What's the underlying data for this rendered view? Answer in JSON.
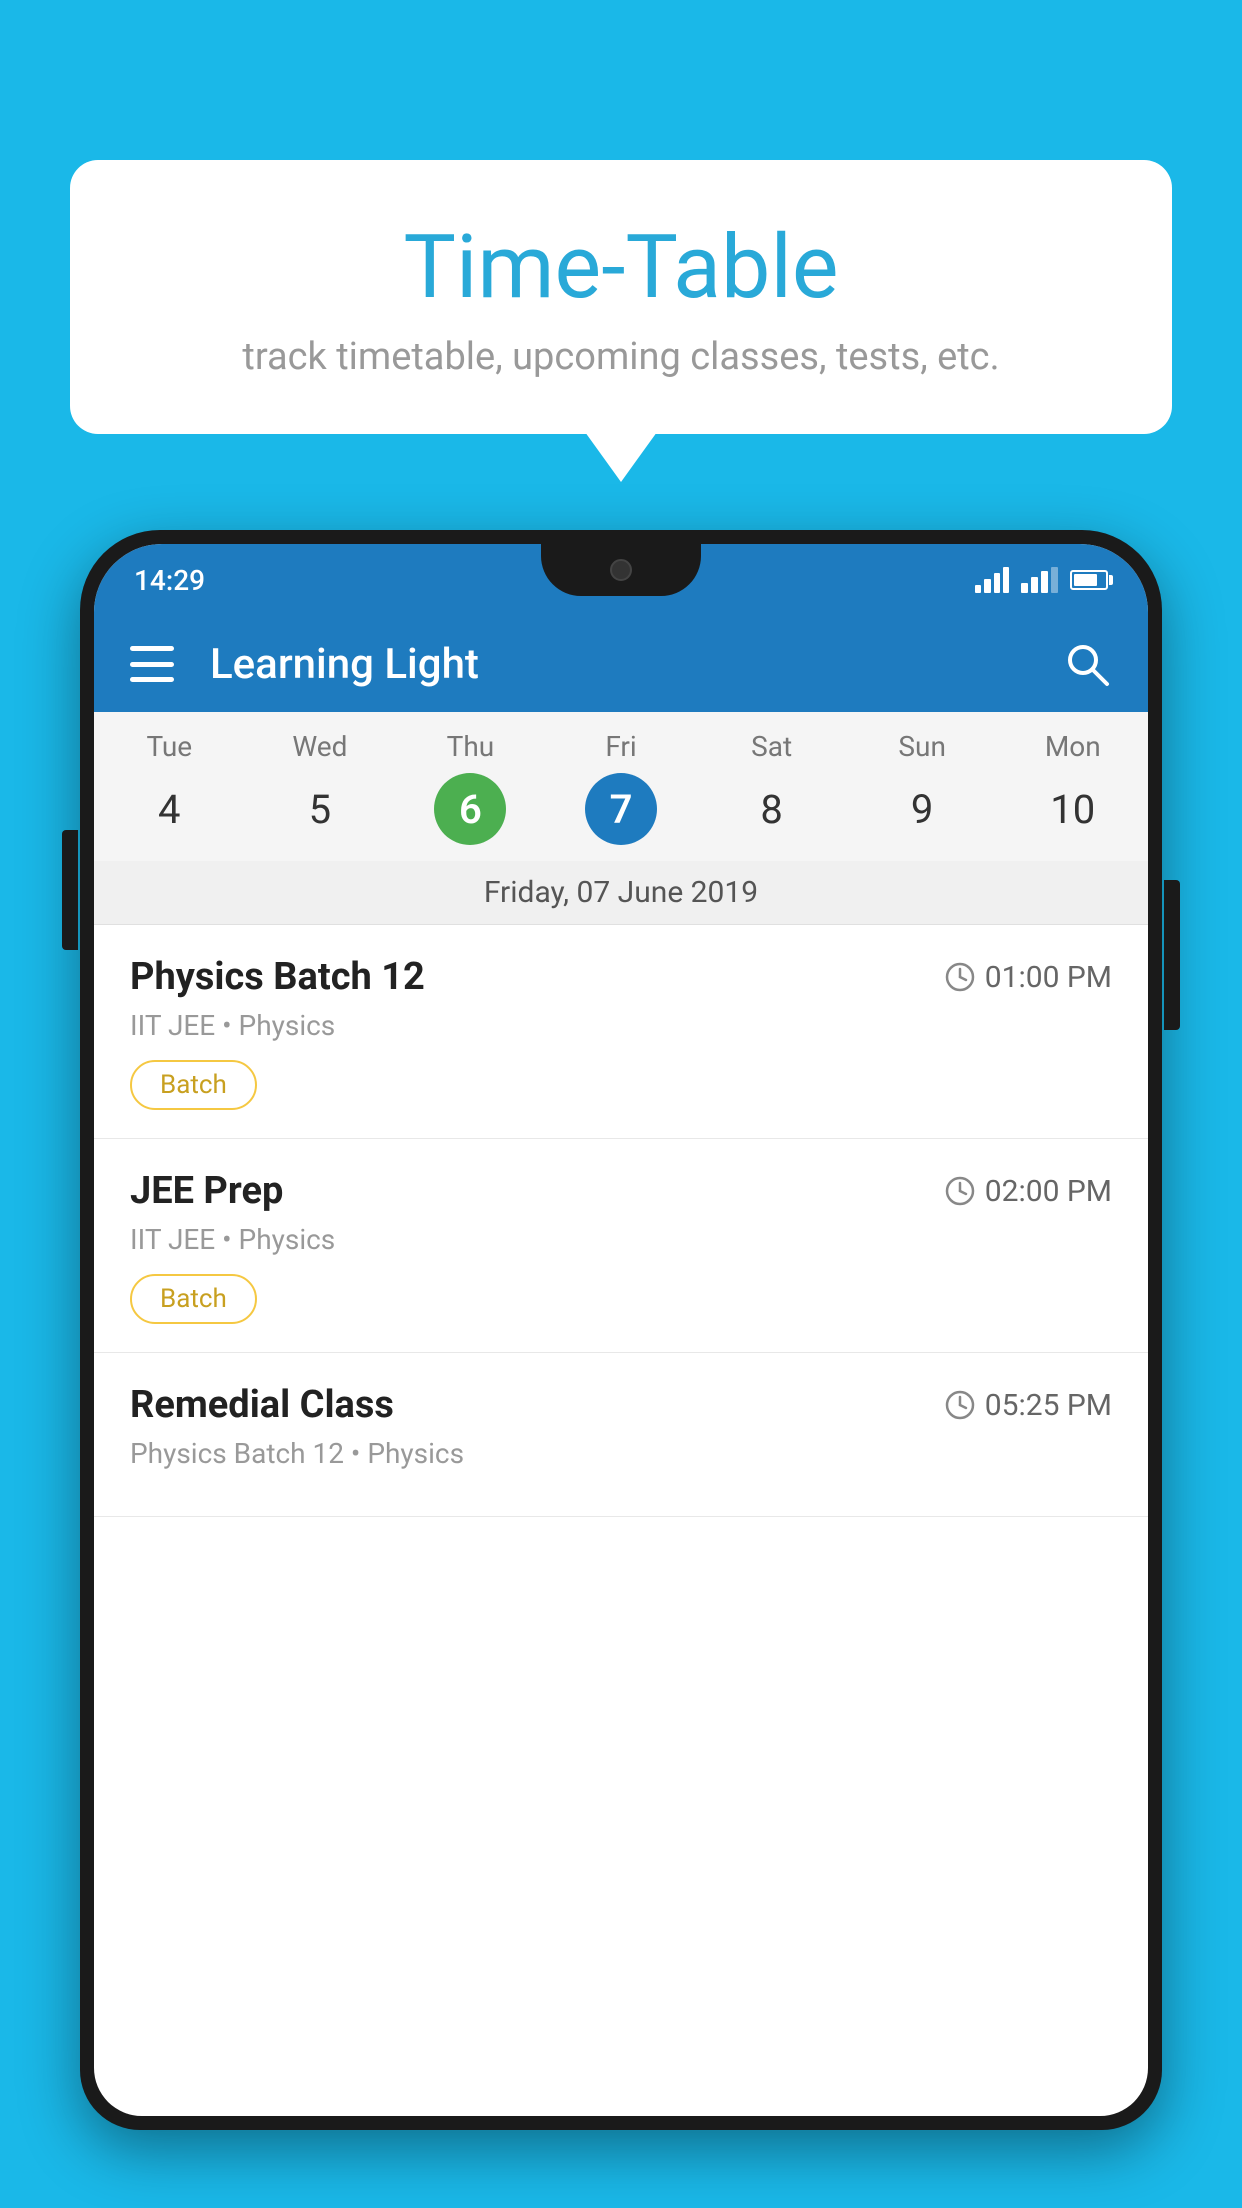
{
  "background_color": "#1ab8e8",
  "bubble": {
    "title": "Time-Table",
    "subtitle": "track timetable, upcoming classes, tests, etc."
  },
  "phone": {
    "status_bar": {
      "time": "14:29"
    },
    "app_bar": {
      "title": "Learning Light"
    },
    "calendar": {
      "days": [
        {
          "name": "Tue",
          "num": "4",
          "state": "normal"
        },
        {
          "name": "Wed",
          "num": "5",
          "state": "normal"
        },
        {
          "name": "Thu",
          "num": "6",
          "state": "today"
        },
        {
          "name": "Fri",
          "num": "7",
          "state": "selected"
        },
        {
          "name": "Sat",
          "num": "8",
          "state": "normal"
        },
        {
          "name": "Sun",
          "num": "9",
          "state": "normal"
        },
        {
          "name": "Mon",
          "num": "10",
          "state": "normal"
        }
      ],
      "selected_date_label": "Friday, 07 June 2019"
    },
    "schedule": [
      {
        "title": "Physics Batch 12",
        "time": "01:00 PM",
        "subtitle": "IIT JEE • Physics",
        "badge": "Batch"
      },
      {
        "title": "JEE Prep",
        "time": "02:00 PM",
        "subtitle": "IIT JEE • Physics",
        "badge": "Batch"
      },
      {
        "title": "Remedial Class",
        "time": "05:25 PM",
        "subtitle": "Physics Batch 12 • Physics",
        "badge": ""
      }
    ]
  }
}
